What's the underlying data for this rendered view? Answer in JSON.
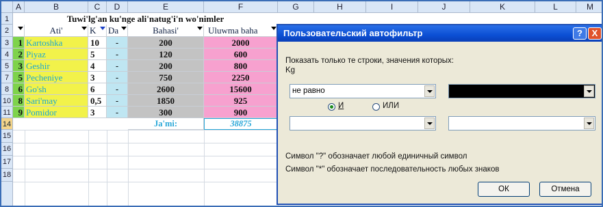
{
  "columns": [
    "A",
    "B",
    "C",
    "D",
    "E",
    "F",
    "G",
    "H",
    "I",
    "J",
    "K",
    "L",
    "M"
  ],
  "rows": [
    "1",
    "2",
    "3",
    "4",
    "5",
    "7",
    "8",
    "10",
    "11",
    "14",
    "15",
    "16",
    "17",
    "18"
  ],
  "sheet_title": "Tuwi'lg'an ku'nge ali'natug'i'n wo'nimler",
  "headers": {
    "a": "",
    "b": "Ati'",
    "c": "K",
    "d": "Da",
    "e": "Bahasi'",
    "f": "Uluwma baha"
  },
  "data_rows": [
    {
      "num": "1",
      "name": "Kartoshka",
      "kg": "10",
      "d": "-",
      "price": "200",
      "total": "2000"
    },
    {
      "num": "2",
      "name": "Piyaz",
      "kg": "5",
      "d": "-",
      "price": "120",
      "total": "600"
    },
    {
      "num": "3",
      "name": "Geshir",
      "kg": "4",
      "d": "-",
      "price": "200",
      "total": "800"
    },
    {
      "num": "5",
      "name": "Pecheniye",
      "kg": "3",
      "d": "-",
      "price": "750",
      "total": "2250"
    },
    {
      "num": "6",
      "name": "Go'sh",
      "kg": "6",
      "d": "-",
      "price": "2600",
      "total": "15600"
    },
    {
      "num": "8",
      "name": "Sari'may",
      "kg": "0,5",
      "d": "-",
      "price": "1850",
      "total": "925"
    },
    {
      "num": "9",
      "name": "Pomidor",
      "kg": "3",
      "d": "-",
      "price": "300",
      "total": "900"
    }
  ],
  "sum_label": "Ja'mi:",
  "sum_value": "38875",
  "dialog": {
    "title": "Пользовательский автофильтр",
    "help_btn": "?",
    "close_btn": "X",
    "prompt": "Показать только те строки, значения которых:",
    "field": "Kg",
    "op1": "не равно",
    "val1": "",
    "radio_and": "И",
    "radio_or": "ИЛИ",
    "op2": "",
    "val2": "",
    "hint1": "Символ \"?\" обозначает любой единичный символ",
    "hint2": "Символ \"*\" обозначает последовательность любых знаков",
    "ok": "ОК",
    "cancel": "Отмена"
  },
  "colors": {
    "header_bg": "#d9e6f6",
    "yellow": "#f2f24a",
    "green_num": "#7ed34b",
    "blue_col": "#bfe6f2",
    "grey_col": "#c3c3c3",
    "pink_col": "#f7a1cf",
    "title_bar": "#0b4fd4"
  }
}
